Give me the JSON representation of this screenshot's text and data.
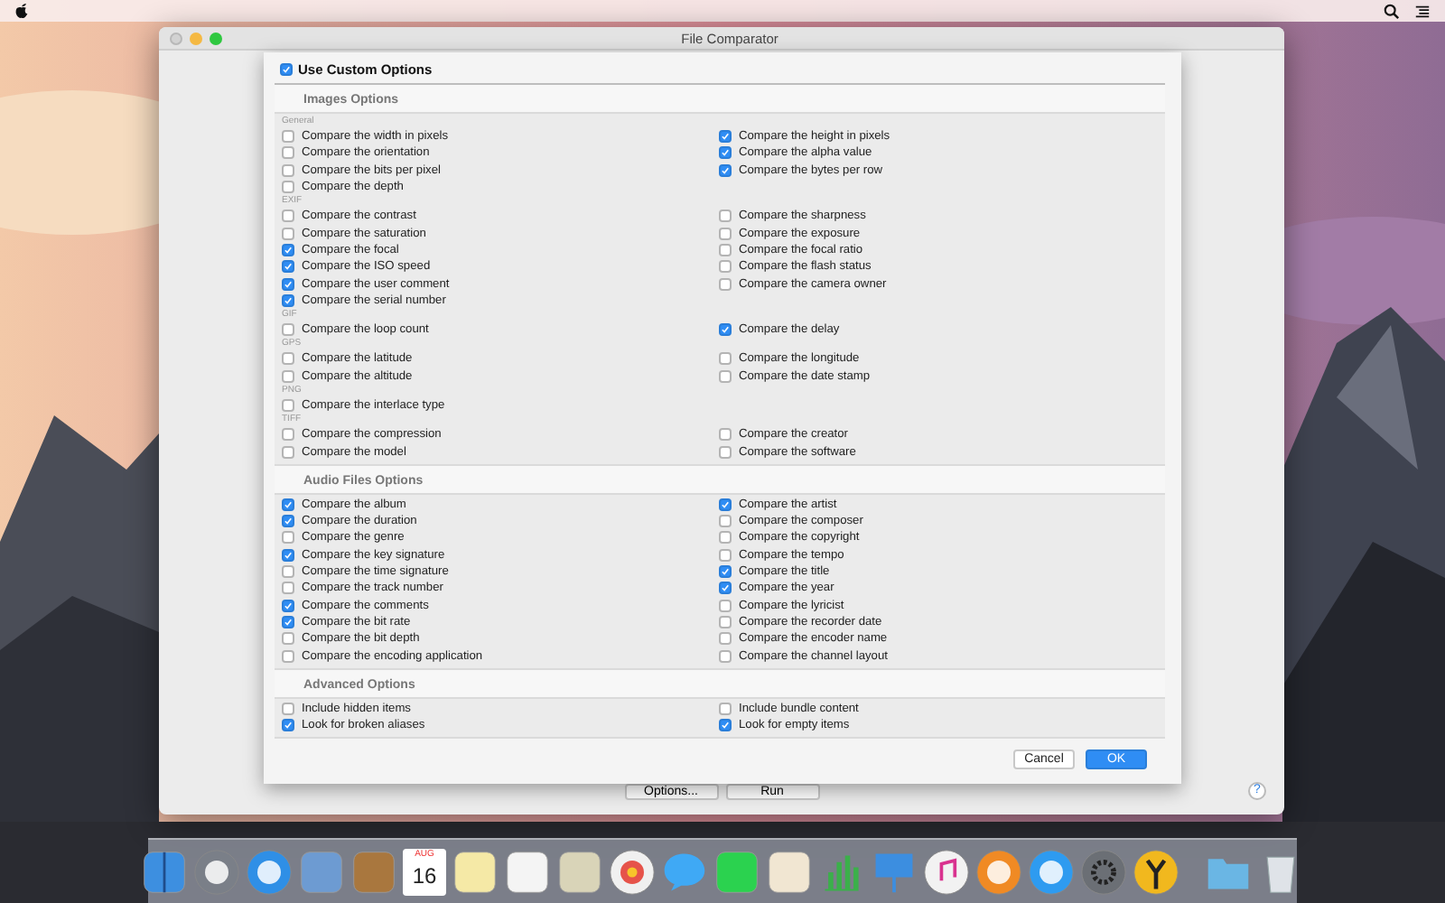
{
  "window": {
    "title": "File Comparator"
  },
  "sheet": {
    "use_custom": {
      "label": "Use Custom Options",
      "checked": true
    },
    "sections": [
      {
        "title": "Images Options",
        "groups": [
          {
            "label": "General",
            "rows": [
              [
                {
                  "label": "Compare the width in pixels",
                  "checked": false
                },
                {
                  "label": "Compare the height in pixels",
                  "checked": true
                }
              ],
              [
                {
                  "label": "Compare the orientation",
                  "checked": false
                },
                {
                  "label": "Compare the alpha value",
                  "checked": true
                }
              ],
              [
                {
                  "label": "Compare the bits per pixel",
                  "checked": false
                },
                {
                  "label": "Compare the bytes per row",
                  "checked": true
                }
              ],
              [
                {
                  "label": "Compare the depth",
                  "checked": false
                }
              ]
            ]
          },
          {
            "label": "EXIF",
            "rows": [
              [
                {
                  "label": "Compare the contrast",
                  "checked": false
                },
                {
                  "label": "Compare the sharpness",
                  "checked": false
                }
              ],
              [
                {
                  "label": "Compare the saturation",
                  "checked": false
                },
                {
                  "label": "Compare the exposure",
                  "checked": false
                }
              ],
              [
                {
                  "label": "Compare the focal",
                  "checked": true
                },
                {
                  "label": "Compare the focal ratio",
                  "checked": false
                }
              ],
              [
                {
                  "label": "Compare the ISO speed",
                  "checked": true
                },
                {
                  "label": "Compare the flash status",
                  "checked": false
                }
              ],
              [
                {
                  "label": "Compare the user comment",
                  "checked": true
                },
                {
                  "label": "Compare the camera owner",
                  "checked": false
                }
              ],
              [
                {
                  "label": "Compare the serial number",
                  "checked": true
                }
              ]
            ]
          },
          {
            "label": "GIF",
            "rows": [
              [
                {
                  "label": "Compare the loop count",
                  "checked": false
                },
                {
                  "label": "Compare the delay",
                  "checked": true
                }
              ]
            ]
          },
          {
            "label": "GPS",
            "rows": [
              [
                {
                  "label": "Compare the latitude",
                  "checked": false
                },
                {
                  "label": "Compare the longitude",
                  "checked": false
                }
              ],
              [
                {
                  "label": "Compare the altitude",
                  "checked": false
                },
                {
                  "label": "Compare the date stamp",
                  "checked": false
                }
              ]
            ]
          },
          {
            "label": "PNG",
            "rows": [
              [
                {
                  "label": "Compare the interlace type",
                  "checked": false
                }
              ]
            ]
          },
          {
            "label": "TIFF",
            "rows": [
              [
                {
                  "label": "Compare the compression",
                  "checked": false
                },
                {
                  "label": "Compare the creator",
                  "checked": false
                }
              ],
              [
                {
                  "label": "Compare the model",
                  "checked": false
                },
                {
                  "label": "Compare the software",
                  "checked": false
                }
              ]
            ]
          }
        ]
      },
      {
        "title": "Audio Files Options",
        "groups": [
          {
            "rows": [
              [
                {
                  "label": "Compare the album",
                  "checked": true
                },
                {
                  "label": "Compare the artist",
                  "checked": true
                }
              ],
              [
                {
                  "label": "Compare the duration",
                  "checked": true
                },
                {
                  "label": "Compare the composer",
                  "checked": false
                }
              ],
              [
                {
                  "label": "Compare the genre",
                  "checked": false
                },
                {
                  "label": "Compare the copyright",
                  "checked": false
                }
              ],
              [
                {
                  "label": "Compare the key signature",
                  "checked": true
                },
                {
                  "label": "Compare the tempo",
                  "checked": false
                }
              ],
              [
                {
                  "label": "Compare the time signature",
                  "checked": false
                },
                {
                  "label": "Compare the title",
                  "checked": true
                }
              ],
              [
                {
                  "label": "Compare the track number",
                  "checked": false
                },
                {
                  "label": "Compare the year",
                  "checked": true
                }
              ],
              [
                {
                  "label": "Compare the comments",
                  "checked": true
                },
                {
                  "label": "Compare the lyricist",
                  "checked": false
                }
              ],
              [
                {
                  "label": "Compare the bit rate",
                  "checked": true
                },
                {
                  "label": "Compare the recorder date",
                  "checked": false
                }
              ],
              [
                {
                  "label": "Compare the bit depth",
                  "checked": false
                },
                {
                  "label": "Compare the encoder name",
                  "checked": false
                }
              ],
              [
                {
                  "label": "Compare the encoding application",
                  "checked": false
                },
                {
                  "label": "Compare the channel layout",
                  "checked": false
                }
              ]
            ]
          }
        ]
      },
      {
        "title": "Advanced Options",
        "groups": [
          {
            "rows": [
              [
                {
                  "label": "Include hidden items",
                  "checked": false
                },
                {
                  "label": "Include bundle content",
                  "checked": false
                }
              ],
              [
                {
                  "label": "Look for broken aliases",
                  "checked": true
                },
                {
                  "label": "Look for empty items",
                  "checked": true
                }
              ]
            ]
          }
        ]
      }
    ],
    "buttons": [
      "Cancel",
      "OK"
    ]
  },
  "window_buttons": [
    "Options...",
    "Run"
  ],
  "help_button": "?",
  "dock": {
    "calendar_month": "AUG",
    "calendar_day": "16"
  }
}
